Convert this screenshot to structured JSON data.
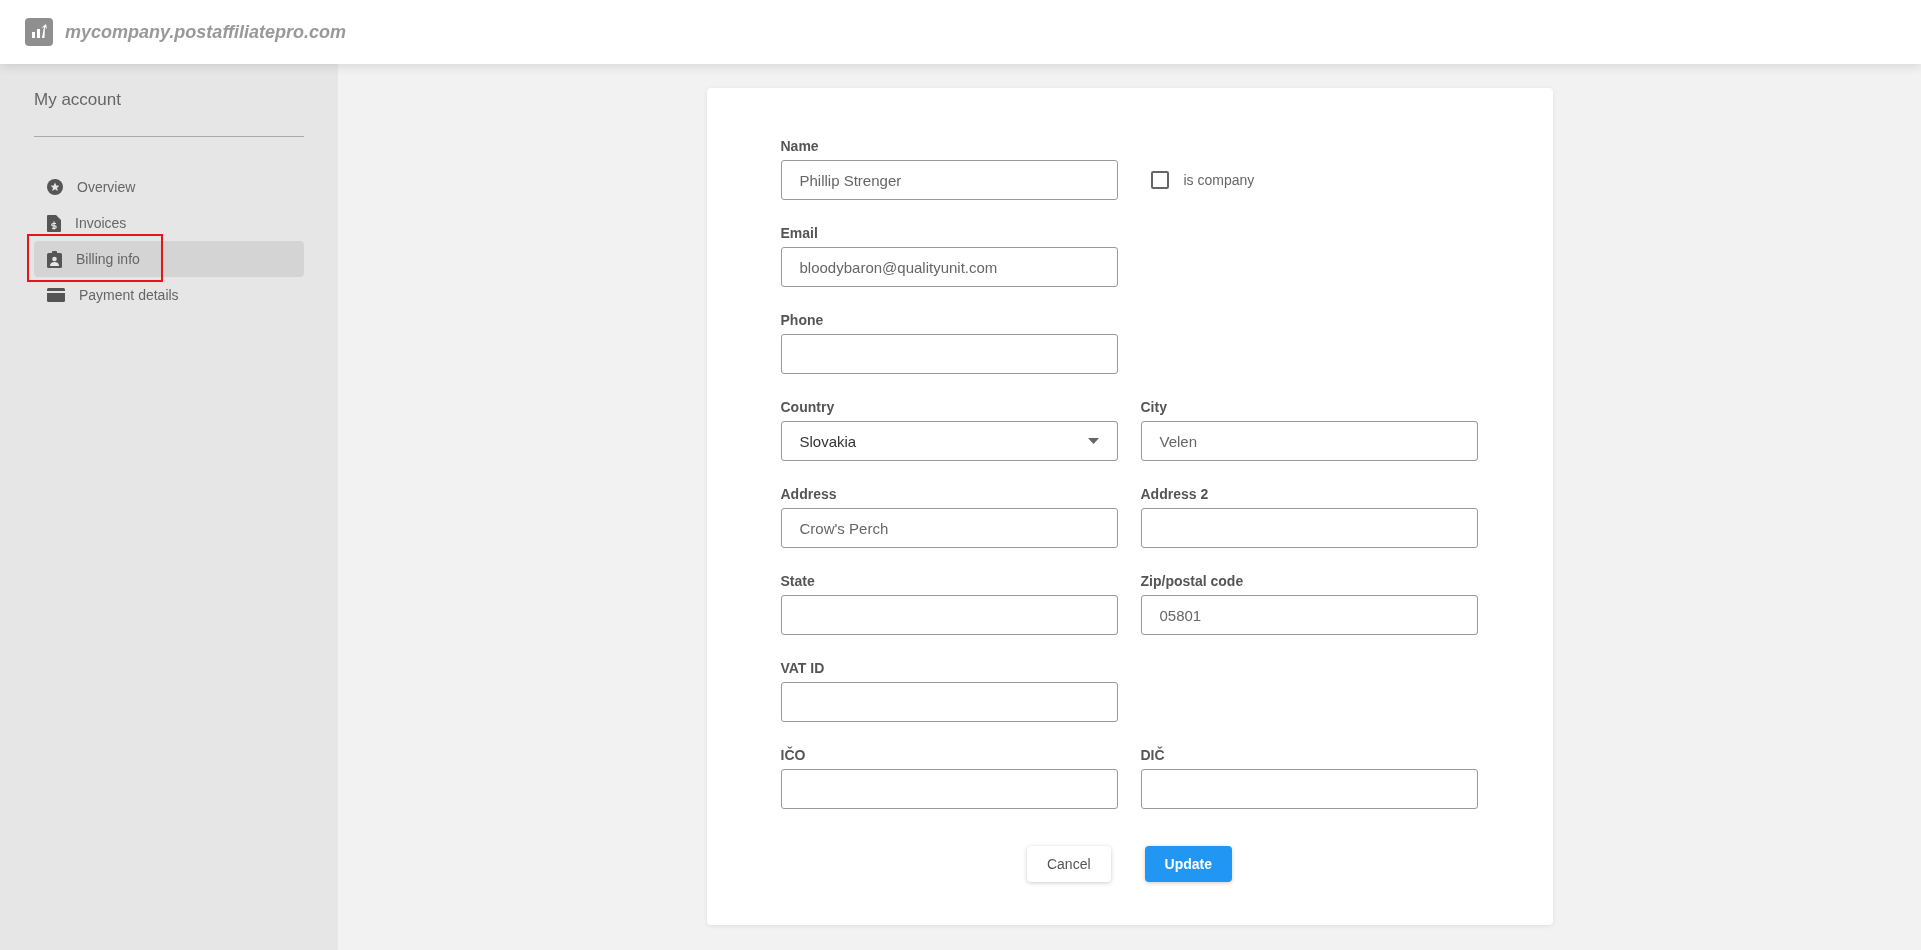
{
  "header": {
    "site": "mycompany.postaffiliatepro.com"
  },
  "sidebar": {
    "title": "My account",
    "items": [
      {
        "label": "Overview",
        "selected": false,
        "annotated": false
      },
      {
        "label": "Invoices",
        "selected": false,
        "annotated": false
      },
      {
        "label": "Billing info",
        "selected": true,
        "annotated": true
      },
      {
        "label": "Payment details",
        "selected": false,
        "annotated": false
      }
    ]
  },
  "form": {
    "rows": [
      [
        {
          "kind": "text",
          "label": "Name",
          "value": "Phillip Strenger"
        },
        {
          "kind": "checkbox",
          "label": "is company",
          "checked": false
        }
      ],
      [
        {
          "kind": "text",
          "label": "Email",
          "value": "bloodybaron@qualityunit.com"
        }
      ],
      [
        {
          "kind": "text",
          "label": "Phone"
        }
      ],
      [
        {
          "kind": "select",
          "label": "Country",
          "value": "Slovakia"
        },
        {
          "kind": "text",
          "label": "City",
          "value": "Velen"
        }
      ],
      [
        {
          "kind": "text",
          "label": "Address",
          "value": "Crow's Perch"
        },
        {
          "kind": "text",
          "label": "Address 2"
        }
      ],
      [
        {
          "kind": "text",
          "label": "State"
        },
        {
          "kind": "text",
          "label": "Zip/postal code",
          "value": "05801"
        }
      ],
      [
        {
          "kind": "text",
          "label": "VAT ID"
        }
      ],
      [
        {
          "kind": "text",
          "label": "IČO"
        },
        {
          "kind": "text",
          "label": "DIČ"
        }
      ]
    ],
    "buttons": [
      {
        "label": "Cancel",
        "kind": "secondary"
      },
      {
        "label": "Update",
        "kind": "primary"
      }
    ]
  }
}
